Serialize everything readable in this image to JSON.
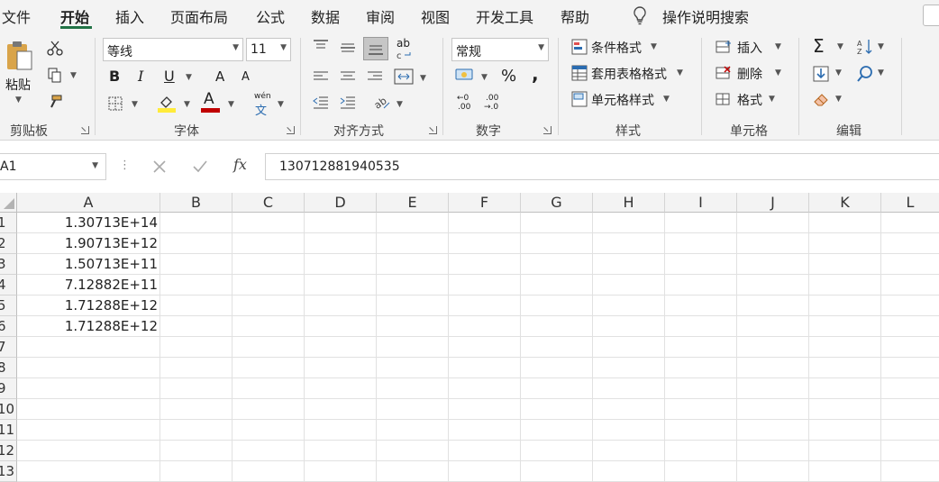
{
  "menu": {
    "items": [
      "文件",
      "开始",
      "插入",
      "页面布局",
      "公式",
      "数据",
      "审阅",
      "视图",
      "开发工具",
      "帮助"
    ],
    "search": "操作说明搜索"
  },
  "ribbon": {
    "clipboard": {
      "paste": "粘贴",
      "group": "剪贴板"
    },
    "font": {
      "name": "等线",
      "size": "11",
      "bold": "B",
      "italic": "I",
      "underline": "U",
      "grow": "A",
      "shrink": "A",
      "font_color": "A",
      "phonetic_top": "wén",
      "phonetic_bottom": "文",
      "group": "字体"
    },
    "alignment": {
      "group": "对齐方式",
      "wrap": "ab"
    },
    "number": {
      "format": "常规",
      "percent": "%",
      "comma": ",",
      "inc_top": "←0",
      "inc_bottom": ".00",
      "dec_top": ".00",
      "dec_bottom": "→.0",
      "group": "数字"
    },
    "styles": {
      "conditional": "条件格式",
      "table": "套用表格格式",
      "cell": "单元格样式",
      "group": "样式"
    },
    "cells": {
      "insert": "插入",
      "delete": "删除",
      "format": "格式",
      "group": "单元格"
    },
    "editing": {
      "sum": "Σ",
      "group": "编辑"
    }
  },
  "formula_bar": {
    "name_box": "A1",
    "fx": "fx",
    "value": "130712881940535"
  },
  "sheet": {
    "columns": [
      "A",
      "B",
      "C",
      "D",
      "E",
      "F",
      "G",
      "H",
      "I",
      "J",
      "K",
      "L"
    ],
    "rows": [
      "1",
      "2",
      "3",
      "4",
      "5",
      "6",
      "7",
      "8",
      "9",
      "10",
      "11",
      "12",
      "13"
    ],
    "values": [
      "1.30713E+14",
      "1.90713E+12",
      "1.50713E+11",
      "7.12882E+11",
      "1.71288E+12",
      "1.71288E+12"
    ]
  },
  "colors": {
    "accent": "#217346",
    "ribbon_bg": "#f3f3f3",
    "fill_yellow": "#ffeb3b",
    "font_red": "#c00000"
  }
}
